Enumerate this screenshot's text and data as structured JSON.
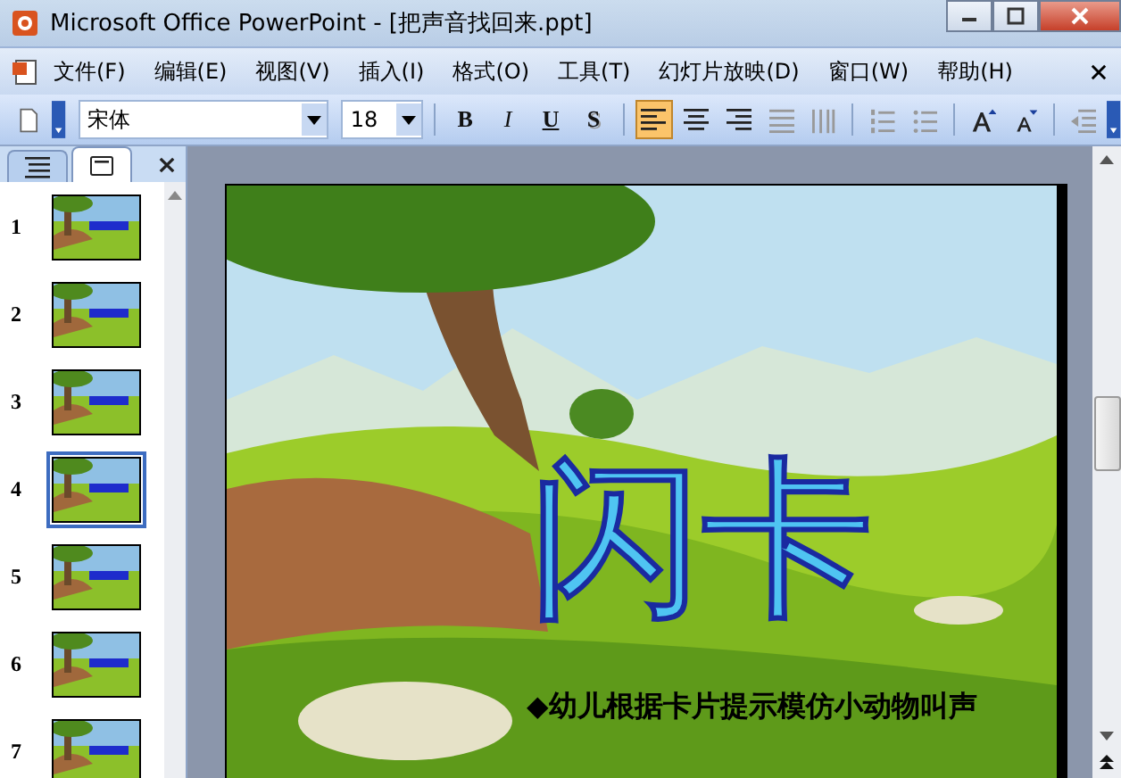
{
  "window": {
    "title": "Microsoft Office PowerPoint - [把声音找回来.ppt]"
  },
  "menu": [
    {
      "label": "文件(F)"
    },
    {
      "label": "编辑(E)"
    },
    {
      "label": "视图(V)"
    },
    {
      "label": "插入(I)"
    },
    {
      "label": "格式(O)"
    },
    {
      "label": "工具(T)"
    },
    {
      "label": "幻灯片放映(D)"
    },
    {
      "label": "窗口(W)"
    },
    {
      "label": "帮助(H)"
    }
  ],
  "toolbar": {
    "font": "宋体",
    "size": "18",
    "styles": [
      {
        "label": "B",
        "kind": "bold"
      },
      {
        "label": "I",
        "kind": "italic"
      },
      {
        "label": "U",
        "kind": "underline"
      },
      {
        "label": "S",
        "kind": "shadow"
      }
    ],
    "align": [
      {
        "kind": "left",
        "selected": true
      },
      {
        "kind": "center",
        "selected": false
      },
      {
        "kind": "right",
        "selected": false
      }
    ]
  },
  "pane_tabs": [
    {
      "kind": "outline",
      "selected": false
    },
    {
      "kind": "slides",
      "selected": true
    }
  ],
  "slides": [
    {
      "number": "1",
      "selected": false
    },
    {
      "number": "2",
      "selected": false
    },
    {
      "number": "3",
      "selected": false
    },
    {
      "number": "4",
      "selected": true
    },
    {
      "number": "5",
      "selected": false
    },
    {
      "number": "6",
      "selected": false
    },
    {
      "number": "7",
      "selected": false
    }
  ],
  "slide": {
    "title": "闪卡",
    "bullet": "◆幼儿根据卡片提示模仿小动物叫声"
  }
}
